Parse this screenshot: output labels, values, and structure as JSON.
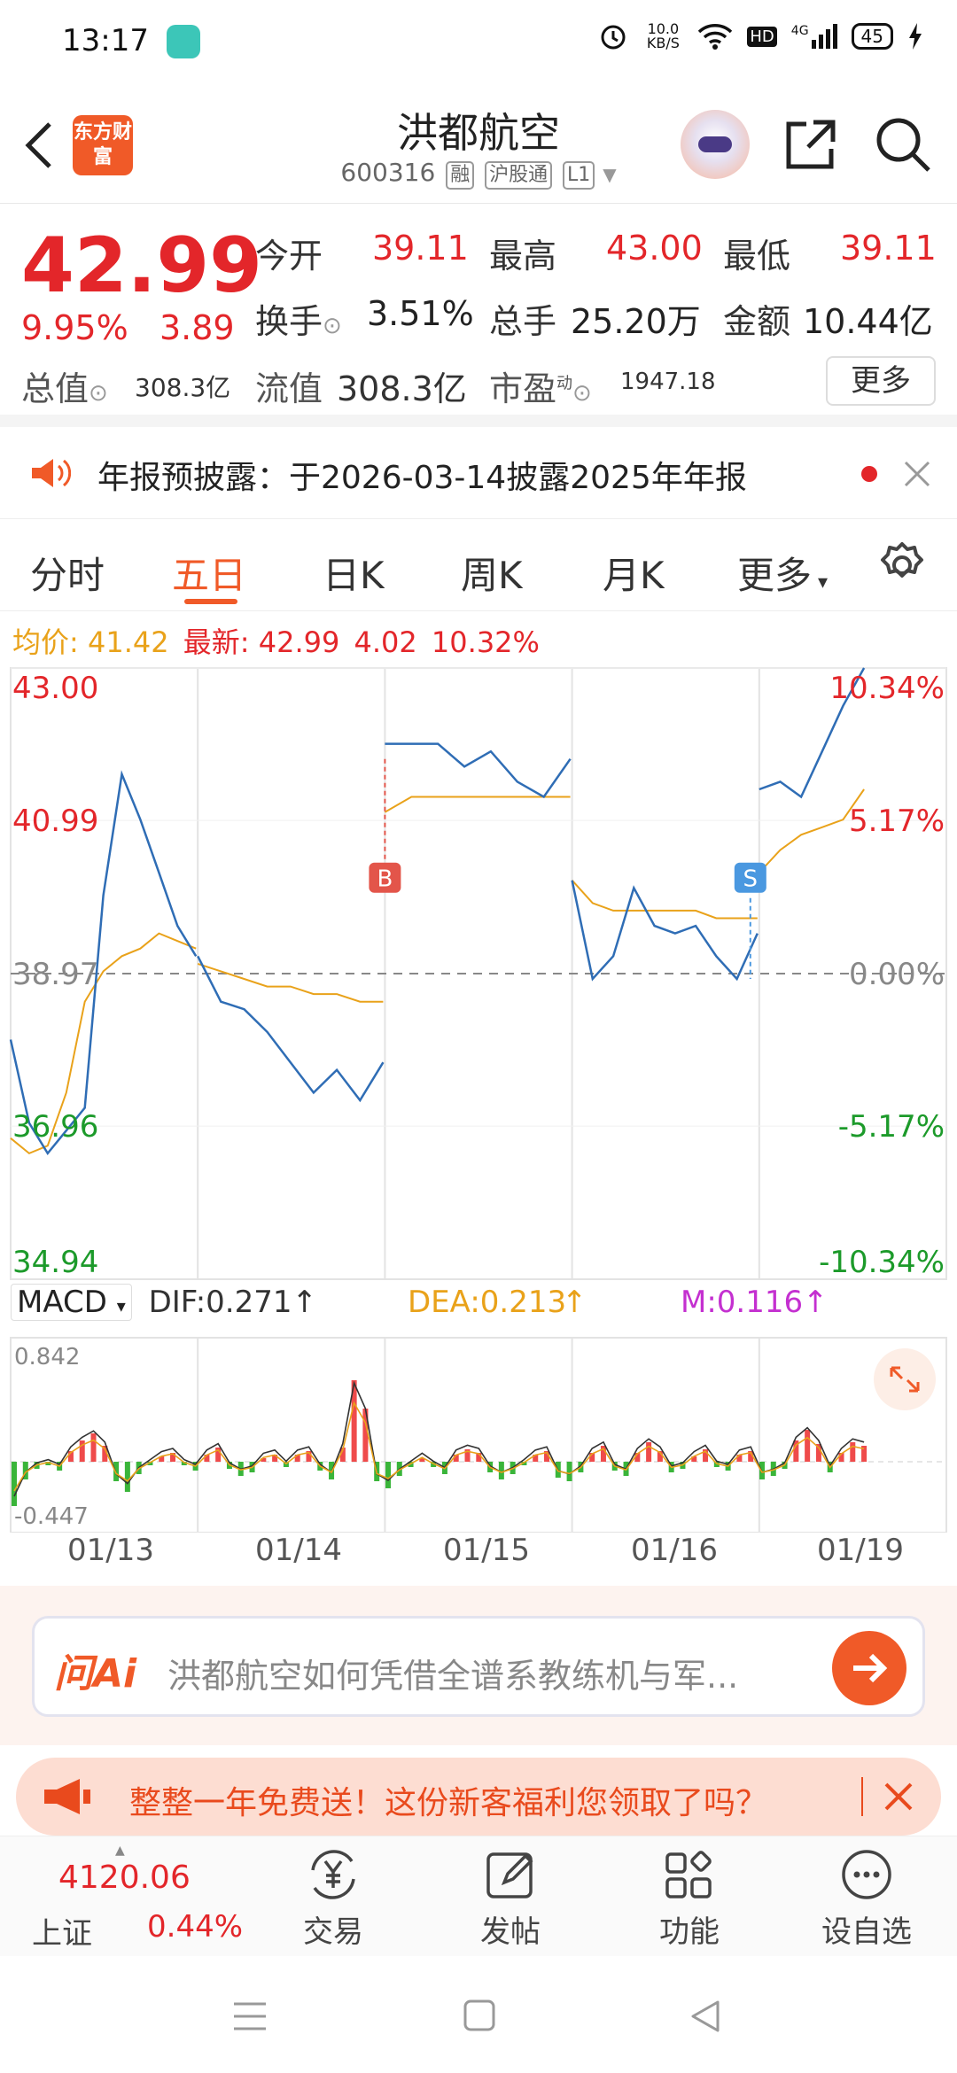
{
  "status": {
    "time": "13:17",
    "net_speed": "10.0 KB/S",
    "signal_label": "4G",
    "hd_label": "HD",
    "battery": "45"
  },
  "header": {
    "logo": "东方财富",
    "title": "洪都航空",
    "code": "600316",
    "tags": [
      "融",
      "沪股通",
      "L1"
    ]
  },
  "quote": {
    "price": "42.99",
    "change_pct": "9.95%",
    "change": "3.89",
    "rows": [
      [
        {
          "label": "今开",
          "value": "39.11"
        },
        {
          "label": "最高",
          "value": "43.00"
        },
        {
          "label": "最低",
          "value": "39.11"
        }
      ],
      [
        {
          "label": "换手",
          "value": "3.51%"
        },
        {
          "label": "总手",
          "value": "25.20万"
        },
        {
          "label": "金额",
          "value": "10.44亿"
        }
      ]
    ],
    "total_value_label": "总值",
    "total_value": "308.3亿",
    "float_value_label": "流值",
    "float_value": "308.3亿",
    "pe_label": "市盈",
    "pe_superscript": "动",
    "pe_value": "1947.18",
    "more_label": "更多"
  },
  "notice": {
    "text": "年报预披露：于2026-03-14披露2025年年报"
  },
  "tabs": [
    "分时",
    "五日",
    "日K",
    "周K",
    "月K",
    "更多"
  ],
  "active_tab": "五日",
  "legend": {
    "avg_label": "均价:",
    "avg_value": "41.42",
    "latest_label": "最新:",
    "latest_value": "42.99",
    "latest_change": "4.02",
    "latest_pct": "10.32%"
  },
  "chart_data": {
    "type": "line",
    "x": [
      "01/13",
      "01/14",
      "01/15",
      "01/16",
      "01/19"
    ],
    "y_ticks_left": [
      "43.00",
      "40.99",
      "38.97",
      "36.96",
      "34.94"
    ],
    "y_ticks_right": [
      "10.34%",
      "5.17%",
      "0.00%",
      "-5.17%",
      "-10.34%"
    ],
    "ylim": [
      34.94,
      43.0
    ],
    "prev_close": 38.97,
    "series": [
      {
        "name": "最新",
        "values": [
          38.1,
          37.0,
          36.6,
          36.9,
          37.2,
          40.0,
          41.6,
          41.0,
          40.3,
          39.6,
          39.2,
          39.2,
          38.6,
          38.5,
          38.2,
          37.8,
          37.4,
          37.7,
          37.3,
          37.8,
          42.0,
          42.0,
          42.0,
          41.7,
          41.9,
          41.5,
          41.3,
          41.8,
          40.2,
          38.9,
          39.2,
          40.1,
          39.6,
          39.5,
          39.6,
          39.2,
          38.9,
          39.5,
          41.4,
          41.5,
          41.3,
          41.9,
          42.5,
          43.0
        ]
      },
      {
        "name": "均价",
        "values": [
          36.8,
          36.6,
          36.7,
          37.4,
          38.6,
          39.0,
          39.2,
          39.3,
          39.5,
          39.4,
          39.3,
          39.1,
          39.0,
          38.9,
          38.8,
          38.8,
          38.7,
          38.7,
          38.6,
          38.6,
          41.1,
          41.3,
          41.3,
          41.3,
          41.3,
          41.3,
          41.3,
          41.3,
          40.2,
          39.9,
          39.8,
          39.8,
          39.8,
          39.8,
          39.8,
          39.7,
          39.7,
          39.7,
          40.3,
          40.6,
          40.8,
          40.9,
          41.0,
          41.4
        ]
      }
    ],
    "markers": [
      {
        "label": "B",
        "x": "01/15"
      },
      {
        "label": "S",
        "x": "01/16"
      }
    ],
    "macd": {
      "selector": "MACD",
      "dif": "DIF:0.271",
      "dea": "DEA:0.213",
      "m": "M:0.116",
      "top": "0.842",
      "bottom": "-0.447"
    }
  },
  "ai": {
    "logo": "问Ai",
    "prompt": "洪都航空如何凭借全谱系教练机与军..."
  },
  "promo": {
    "text": "整整一年免费送！这份新客福利您领取了吗？"
  },
  "bottom": {
    "index_value": "4120.06",
    "index_name": "上证",
    "index_pct": "0.44%",
    "items": [
      "交易",
      "发帖",
      "功能",
      "设自选"
    ]
  }
}
